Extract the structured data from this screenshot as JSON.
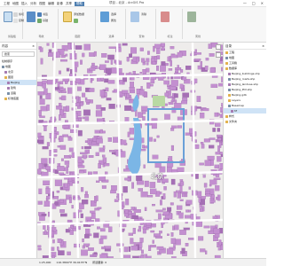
{
  "app": {
    "title": "项目 - 北京 - ArcGIS Pro",
    "tabs": [
      "工程",
      "地图",
      "插入",
      "分析",
      "视图",
      "编辑",
      "影像",
      "共享",
      "帮助"
    ],
    "active_tab": "帮助"
  },
  "ribbon": {
    "groups": [
      {
        "label": "剪贴板"
      },
      {
        "label": "导航"
      },
      {
        "label": "图层"
      },
      {
        "label": "选择"
      },
      {
        "label": "查询"
      },
      {
        "label": "标注"
      },
      {
        "label": "离线"
      }
    ],
    "buttons": [
      "粘贴",
      "剪切",
      "复制",
      "浏览",
      "书签",
      "基础",
      "添加数据",
      "选择",
      "属性",
      "清除"
    ]
  },
  "left_panel": {
    "title": "内容",
    "rows": [
      "搜索",
      "绘制顺序",
      "地图",
      "北京",
      "图层",
      "Beijing",
      "建筑",
      "道路",
      "标准底图"
    ]
  },
  "map": {
    "label": "北京"
  },
  "right_panel": {
    "title": "目录",
    "rows": [
      "工程",
      "地图",
      "工具箱",
      "数据库",
      "Beijing_buildings.shp",
      "Beijing_roads.shp",
      "Beijing_landuse.shp",
      "Beijing_POI.shp",
      "Beijing.gdb",
      "Layers",
      "Basemap",
      "tif",
      "样式",
      "文件夹"
    ]
  },
  "status": {
    "scale": "1:25,000",
    "coords": "116.3890°E 39.9135°N",
    "selected": "所选要素: 0"
  }
}
